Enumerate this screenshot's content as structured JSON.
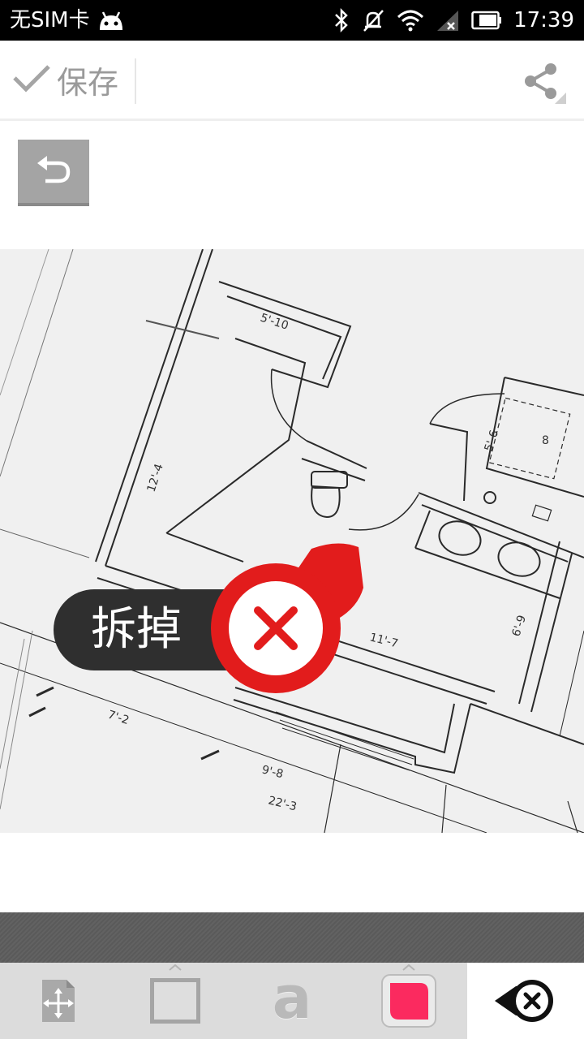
{
  "status_bar": {
    "carrier": "无SIM卡",
    "time": "17:39"
  },
  "action_bar": {
    "save_label": "保存"
  },
  "sticker": {
    "label": "拆掉",
    "accent_color": "#e21c1c"
  },
  "toolbar": {
    "tools": [
      "move-tool",
      "frame-tool",
      "text-tool",
      "color-tool",
      "sticker-tool"
    ],
    "text_tool_glyph": "a",
    "selected_color": "#fb2a5f",
    "active_tool": "sticker-tool"
  },
  "colors": {
    "status_bar": "#000000",
    "undo_button": "#a4a4a4",
    "dark_band": "#5e5e5e",
    "toolbar_bg": "#dcdcdc"
  }
}
